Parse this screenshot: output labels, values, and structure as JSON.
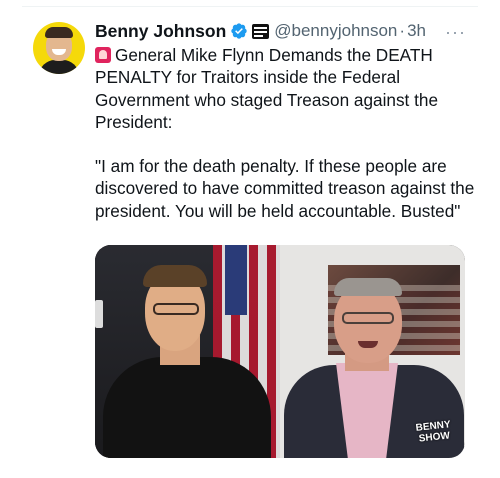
{
  "author": {
    "name": "Benny Johnson",
    "handle": "@bennyjohnson",
    "time": "3h",
    "verified_icon": "verified-badge-icon",
    "affiliation_icon": "affiliate-badge-icon",
    "avatar_icon": "avatar"
  },
  "menu": {
    "more_label": "···"
  },
  "tweet": {
    "paragraph1": "General Mike Flynn Demands the DEATH PENALTY for Traitors inside the Federal Government who staged Treason against the President:",
    "paragraph2": "\"I am for the death penalty. If these people are discovered to have committed treason against the president. You will be held accountable. Busted\"",
    "emoji": "rotating-light-icon"
  },
  "media": {
    "watermark": "BENNY SHOW"
  },
  "colors": {
    "text": "#0f1419",
    "secondary": "#536471",
    "verified_blue": "#1d9bf0",
    "avatar_bg": "#f5d90a"
  }
}
